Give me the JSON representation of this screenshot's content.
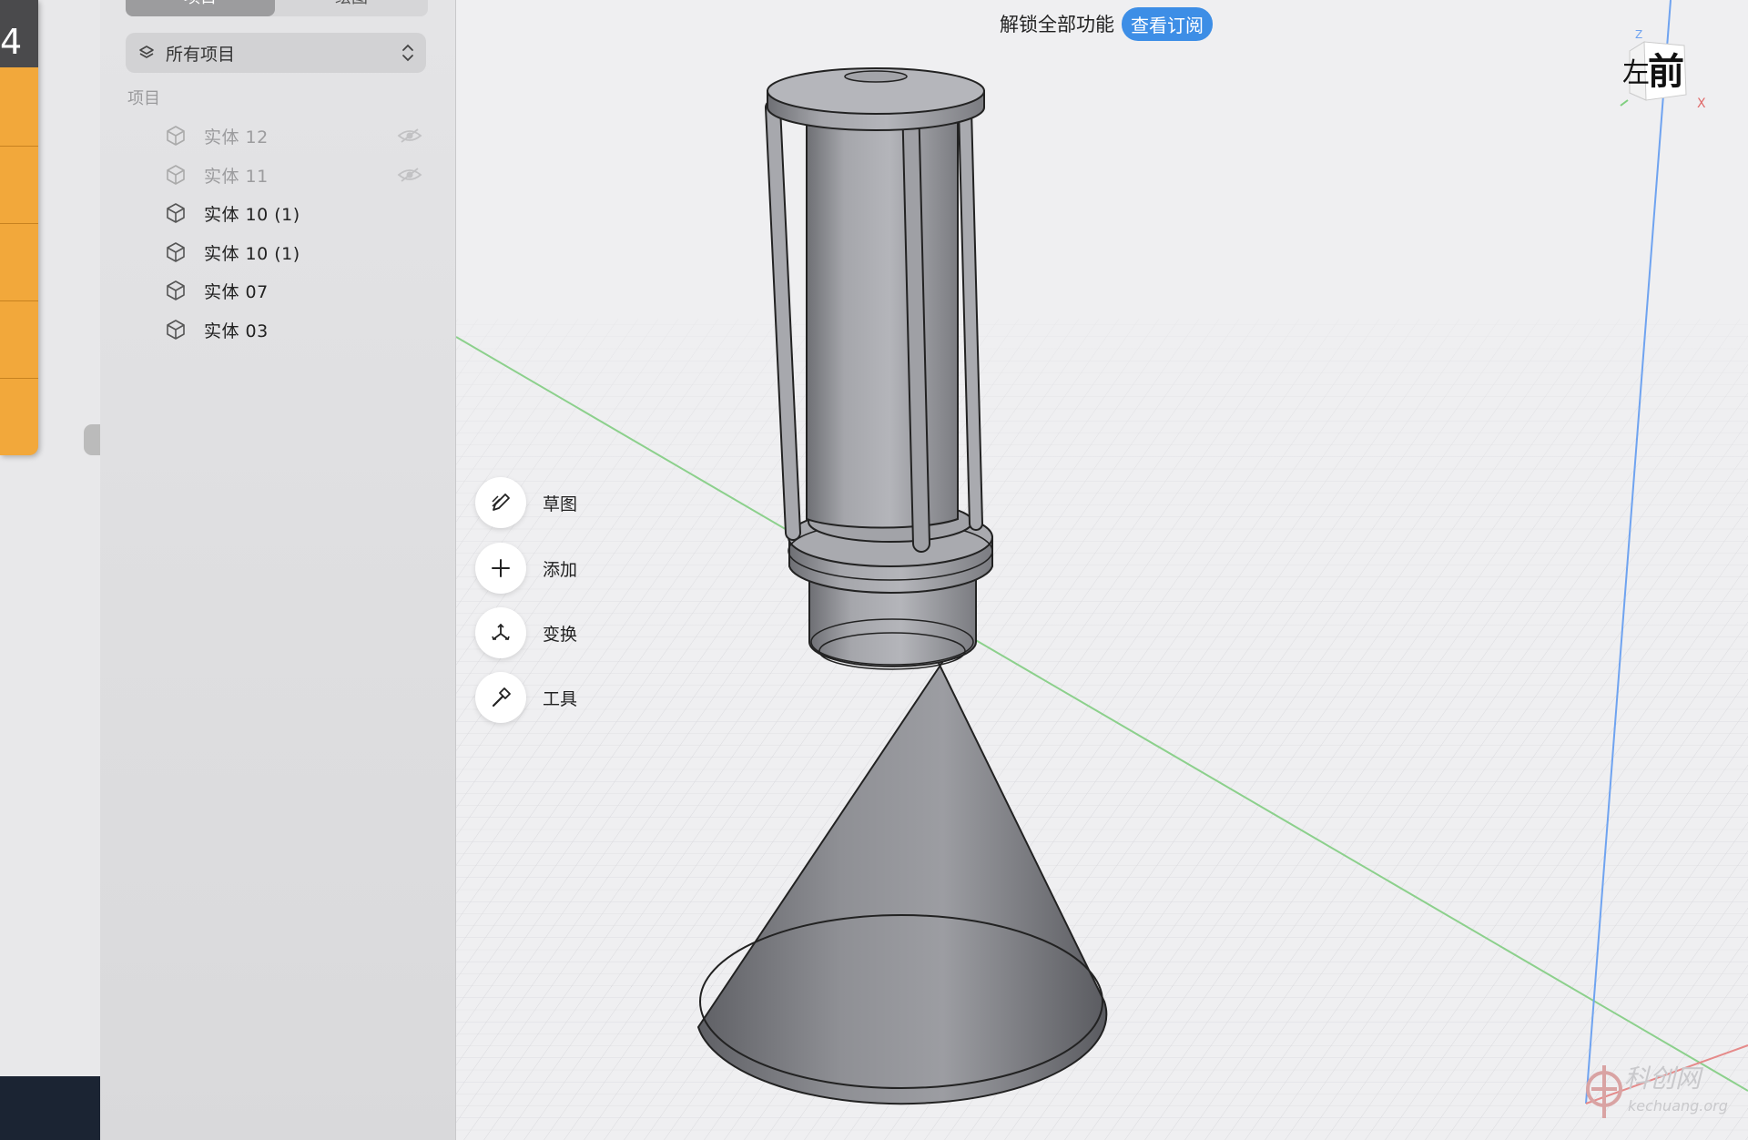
{
  "left_panel": {
    "partial_text": "4"
  },
  "sidebar": {
    "tabs": [
      "项目",
      "绘图"
    ],
    "project_select": {
      "value": "所有项目"
    },
    "section_label": "项目",
    "items": [
      {
        "label": "实体 12",
        "hidden": true
      },
      {
        "label": "实体 11",
        "hidden": true
      },
      {
        "label": "实体 10 (1)",
        "hidden": false
      },
      {
        "label": "实体 10 (1)",
        "hidden": false
      },
      {
        "label": "实体 07",
        "hidden": false
      },
      {
        "label": "实体 03",
        "hidden": false
      }
    ]
  },
  "header": {
    "unlock_text": "解锁全部功能",
    "subscribe_label": "查看订阅"
  },
  "toolbar": {
    "sketch_label": "草图",
    "add_label": "添加",
    "transform_label": "变换",
    "tools_label": "工具"
  },
  "view_cube": {
    "front_label": "前",
    "left_label": "左",
    "axis_z": "Z",
    "axis_x": "X"
  },
  "watermark": {
    "text": "科创网",
    "domain": "kechuang.org"
  },
  "colors": {
    "accent": "#3d8ee6",
    "orange": "#f2a83b",
    "model_gray": "#9a9ba0",
    "axis_green": "#8cd08c",
    "axis_blue": "#6fa3f0"
  }
}
